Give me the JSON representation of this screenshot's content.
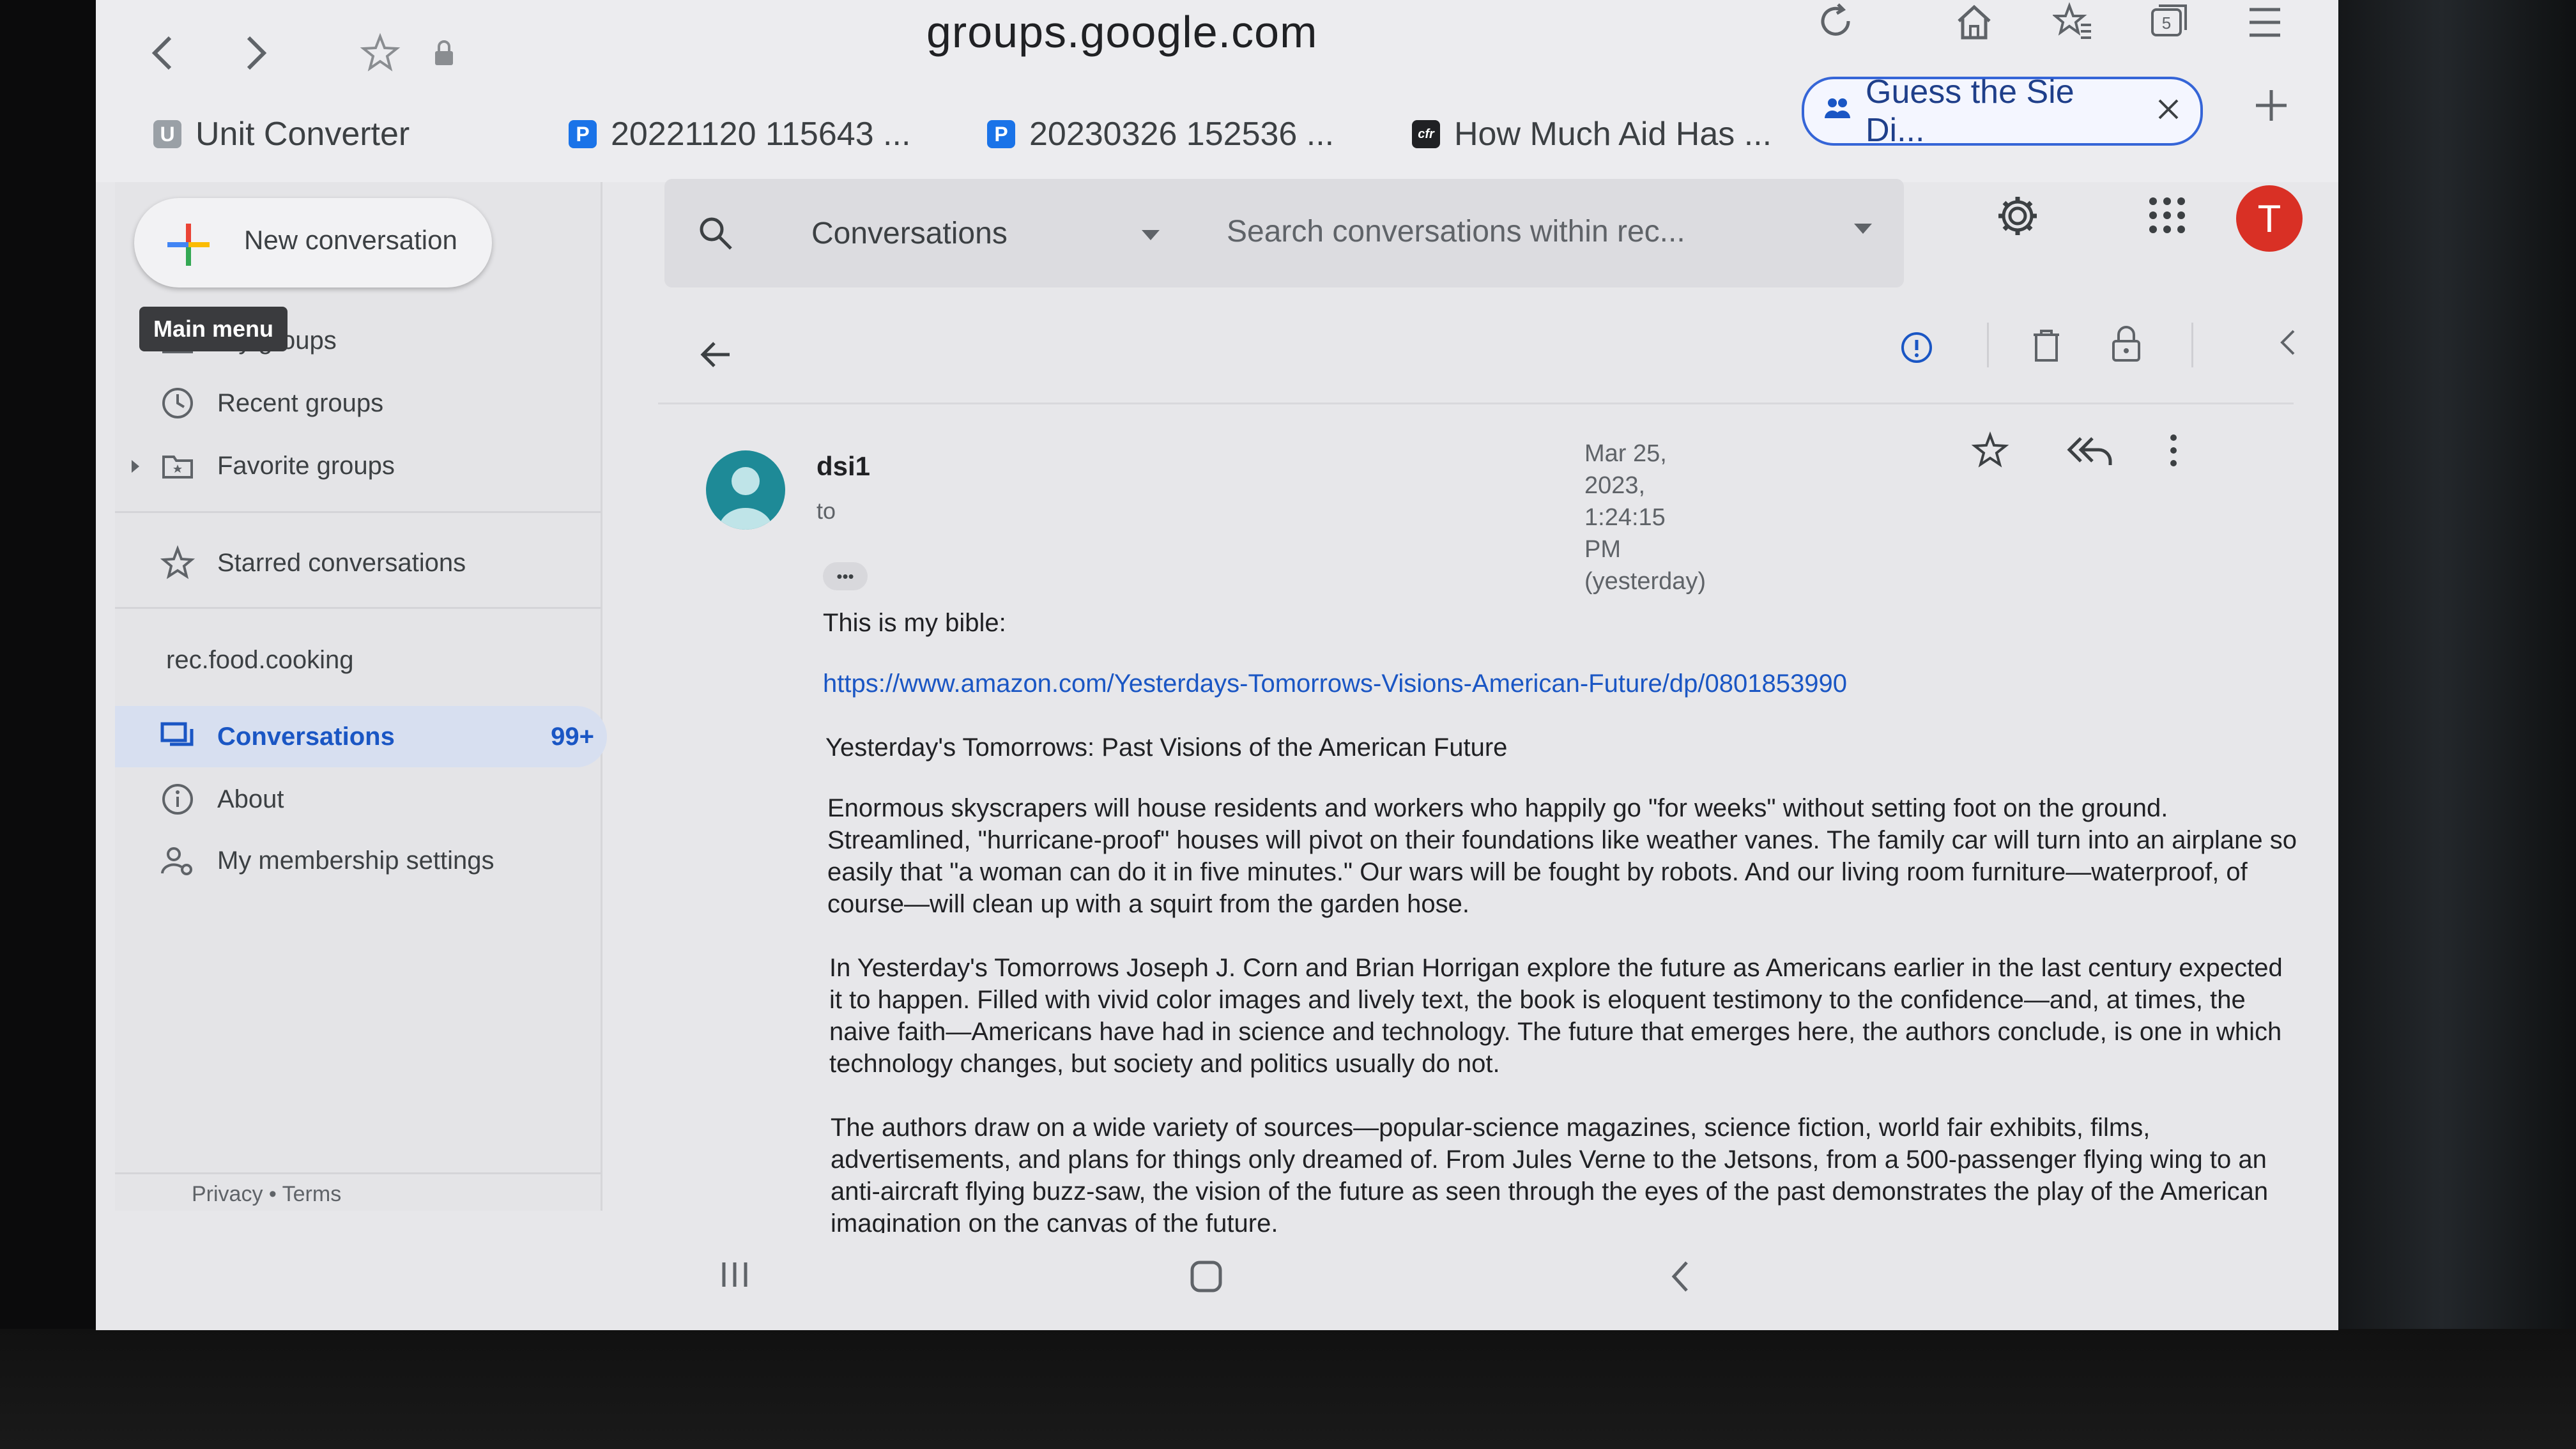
{
  "browser": {
    "url": "groups.google.com",
    "tabs": [
      {
        "label": "Unit Converter",
        "favicon": "U"
      },
      {
        "label": "20221120 115643 ...",
        "favicon": "P"
      },
      {
        "label": "20230326 152536 ...",
        "favicon": "P"
      },
      {
        "label": "How Much Aid Has ...",
        "favicon": "cfr"
      },
      {
        "label": "Guess the Sie Di...",
        "favicon": "group"
      }
    ],
    "tab_count": "5"
  },
  "sidebar": {
    "new_conversation": "New conversation",
    "tooltip": "Main menu",
    "items": [
      {
        "label": "My groups"
      },
      {
        "label": "Recent groups"
      },
      {
        "label": "Favorite groups"
      },
      {
        "label": "Starred conversations"
      }
    ],
    "group_name": "rec.food.cooking",
    "group_items": [
      {
        "label": "Conversations",
        "badge": "99+"
      },
      {
        "label": "About"
      },
      {
        "label": "My membership settings"
      }
    ],
    "footer": "Privacy • Terms"
  },
  "header": {
    "search_scope": "Conversations",
    "search_placeholder": "Search conversations within rec...",
    "avatar_initial": "T"
  },
  "message": {
    "author": "dsi1",
    "to": "to",
    "date": "Mar 25, 2023, 1:24:15 PM (yesterday)",
    "ellipsis": "•••",
    "intro": "This is my bible:",
    "link": "https://www.amazon.com/Yesterdays-Tomorrows-Visions-American-Future/dp/0801853990",
    "book_title": "Yesterday's Tomorrows: Past Visions of the American Future",
    "p1": "Enormous skyscrapers will house residents and workers who happily go \"for weeks\" without setting foot on the ground. Streamlined, \"hurricane-proof\" houses will pivot on their foundations like weather vanes. The family car will turn into an airplane so easily that \"a woman can do it in five minutes.\" Our wars will be fought by robots. And our living room furniture—waterproof, of course—will clean up with a squirt from the garden hose.",
    "p2": "In Yesterday's Tomorrows Joseph J. Corn and Brian Horrigan explore the future as Americans earlier in the last century expected it to happen. Filled with vivid color images and lively text, the book is eloquent testimony to the confidence—and, at times, the naive faith—Americans have had in science and technology. The future that emerges here, the authors conclude, is one in which technology changes, but society and politics usually do not.",
    "p3": "The authors draw on a wide variety of sources—popular-science magazines, science fiction, world fair exhibits, films, advertisements, and plans for things only dreamed of. From Jules Verne to the Jetsons, from a 500-passenger flying wing to an anti-aircraft flying buzz-saw, the vision of the future as seen through the eyes of the past demonstrates the play of the American imagination on the canvas of the future."
  },
  "colors": {
    "accent": "#1a56c4",
    "avatar_red": "#d93025",
    "author_avatar": "#1e8a97"
  }
}
